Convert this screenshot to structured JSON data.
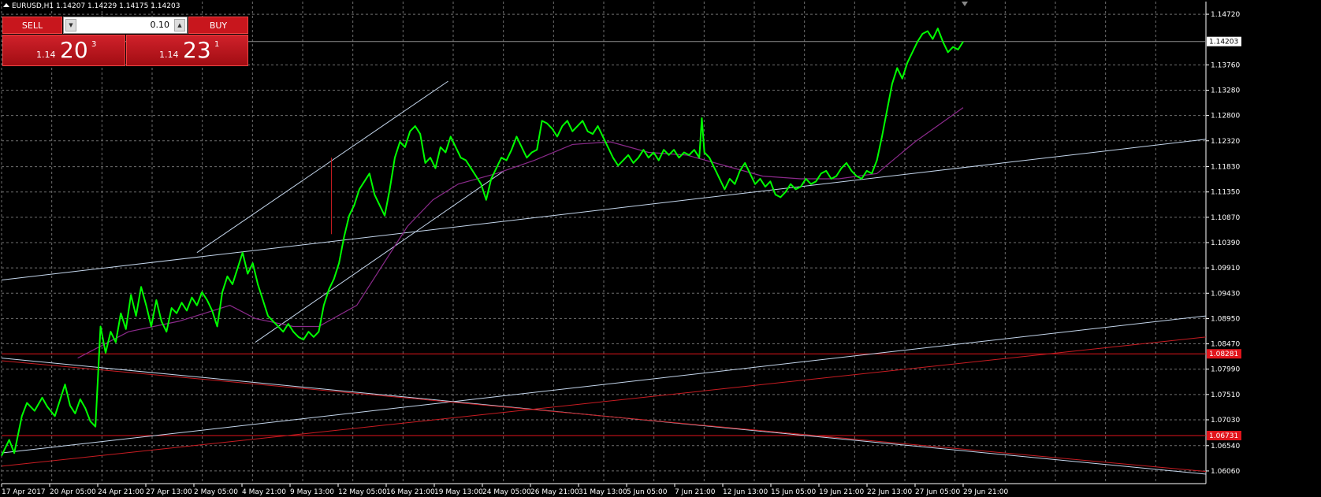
{
  "header": {
    "title": "EURUSD,H1  1.14207 1.14229 1.14175 1.14203"
  },
  "trade_panel": {
    "sell_label": "SELL",
    "buy_label": "BUY",
    "lot": "0.10",
    "sell_prefix": "1.14",
    "sell_big": "20",
    "sell_sup": "3",
    "buy_prefix": "1.14",
    "buy_big": "23",
    "buy_sup": "1"
  },
  "colors": {
    "background": "#000000",
    "grid": "#6f6f6f",
    "candles": "#00ff00",
    "moving_average": "#8b2a8b",
    "trendline": "#c4d6ec",
    "horizontal_level": "#e0141b",
    "red_trendline": "#c81c22"
  },
  "chart_data": {
    "type": "line",
    "symbol": "EURUSD",
    "timeframe": "H1",
    "ohlc_last": {
      "open": 1.14207,
      "high": 1.14229,
      "low": 1.14175,
      "close": 1.14203
    },
    "ylim": [
      1.0582,
      1.1496
    ],
    "y_ticks": [
      "1.14720",
      "1.13760",
      "1.13280",
      "1.12800",
      "1.12320",
      "1.11830",
      "1.11350",
      "1.10870",
      "1.10390",
      "1.09910",
      "1.09430",
      "1.08950",
      "1.08470",
      "1.07990",
      "1.07510",
      "1.07030",
      "1.06540",
      "1.06060"
    ],
    "x_ticks": [
      "17 Apr 2017",
      "20 Apr 05:00",
      "24 Apr 21:00",
      "27 Apr 13:00",
      "2 May 05:00",
      "4 May 21:00",
      "9 May 13:00",
      "12 May 05:00",
      "16 May 21:00",
      "19 May 13:00",
      "24 May 05:00",
      "26 May 21:00",
      "31 May 13:00",
      "5 Jun 05:00",
      "7 Jun 21:00",
      "12 Jun 13:00",
      "15 Jun 05:00",
      "19 Jun 21:00",
      "22 Jun 13:00",
      "27 Jun 05:00",
      "29 Jun 21:00"
    ],
    "price_labels": [
      {
        "text": "1.14203",
        "value": 1.14203
      },
      {
        "text": "1.08281",
        "value": 1.08281
      },
      {
        "text": "1.06731",
        "value": 1.06731
      }
    ],
    "series": [
      {
        "values": [
          [
            0,
            1.0635
          ],
          [
            3,
            1.0665
          ],
          [
            5,
            1.064
          ],
          [
            8,
            1.071
          ],
          [
            10,
            1.0735
          ],
          [
            13,
            1.072
          ],
          [
            16,
            1.0745
          ],
          [
            18,
            1.0728
          ],
          [
            21,
            1.071
          ],
          [
            23,
            1.074
          ],
          [
            25,
            1.077
          ],
          [
            27,
            1.073
          ],
          [
            29,
            1.0715
          ],
          [
            31,
            1.0742
          ],
          [
            33,
            1.0725
          ],
          [
            35,
            1.07
          ],
          [
            37,
            1.069
          ],
          [
            39,
            1.088
          ],
          [
            41,
            1.083
          ],
          [
            43,
            1.087
          ],
          [
            45,
            1.085
          ],
          [
            47,
            1.0905
          ],
          [
            49,
            1.0875
          ],
          [
            51,
            1.094
          ],
          [
            53,
            1.09
          ],
          [
            55,
            1.0955
          ],
          [
            57,
            1.092
          ],
          [
            59,
            1.088
          ],
          [
            61,
            1.093
          ],
          [
            63,
            1.089
          ],
          [
            65,
            1.087
          ],
          [
            67,
            1.0915
          ],
          [
            69,
            1.0905
          ],
          [
            71,
            1.0925
          ],
          [
            73,
            1.091
          ],
          [
            75,
            1.0935
          ],
          [
            77,
            1.092
          ],
          [
            79,
            1.0945
          ],
          [
            81,
            1.093
          ],
          [
            83,
            1.091
          ],
          [
            85,
            1.088
          ],
          [
            87,
            1.0945
          ],
          [
            89,
            1.0975
          ],
          [
            91,
            1.096
          ],
          [
            93,
            1.099
          ],
          [
            95,
            1.102
          ],
          [
            97,
            1.098
          ],
          [
            99,
            1.1
          ],
          [
            101,
            1.096
          ],
          [
            103,
            1.093
          ],
          [
            105,
            1.09
          ],
          [
            107,
            1.089
          ],
          [
            109,
            1.088
          ],
          [
            111,
            1.087
          ],
          [
            113,
            1.0885
          ],
          [
            115,
            1.087
          ],
          [
            117,
            1.086
          ],
          [
            119,
            1.0855
          ],
          [
            121,
            1.087
          ],
          [
            123,
            1.086
          ],
          [
            125,
            1.087
          ],
          [
            127,
            1.092
          ],
          [
            129,
            1.095
          ],
          [
            131,
            1.097
          ],
          [
            133,
            1.1
          ],
          [
            135,
            1.105
          ],
          [
            137,
            1.109
          ],
          [
            139,
            1.111
          ],
          [
            141,
            1.114
          ],
          [
            143,
            1.1155
          ],
          [
            145,
            1.117
          ],
          [
            147,
            1.113
          ],
          [
            149,
            1.111
          ],
          [
            151,
            1.109
          ],
          [
            153,
            1.114
          ],
          [
            155,
            1.12
          ],
          [
            157,
            1.123
          ],
          [
            159,
            1.122
          ],
          [
            161,
            1.125
          ],
          [
            163,
            1.126
          ],
          [
            165,
            1.1245
          ],
          [
            167,
            1.119
          ],
          [
            169,
            1.12
          ],
          [
            171,
            1.118
          ],
          [
            173,
            1.122
          ],
          [
            175,
            1.121
          ],
          [
            177,
            1.124
          ],
          [
            179,
            1.122
          ],
          [
            181,
            1.12
          ],
          [
            183,
            1.1195
          ],
          [
            185,
            1.118
          ],
          [
            187,
            1.1165
          ],
          [
            189,
            1.115
          ],
          [
            191,
            1.112
          ],
          [
            193,
            1.116
          ],
          [
            195,
            1.118
          ],
          [
            197,
            1.12
          ],
          [
            199,
            1.1195
          ],
          [
            201,
            1.1215
          ],
          [
            203,
            1.124
          ],
          [
            205,
            1.122
          ],
          [
            207,
            1.12
          ],
          [
            209,
            1.121
          ],
          [
            211,
            1.1215
          ],
          [
            213,
            1.127
          ],
          [
            215,
            1.1265
          ],
          [
            217,
            1.1255
          ],
          [
            219,
            1.124
          ],
          [
            221,
            1.126
          ],
          [
            223,
            1.127
          ],
          [
            225,
            1.125
          ],
          [
            227,
            1.126
          ],
          [
            229,
            1.127
          ],
          [
            231,
            1.125
          ],
          [
            233,
            1.1245
          ],
          [
            235,
            1.126
          ],
          [
            237,
            1.124
          ],
          [
            239,
            1.122
          ],
          [
            241,
            1.12
          ],
          [
            243,
            1.1185
          ],
          [
            245,
            1.1195
          ],
          [
            247,
            1.1205
          ],
          [
            249,
            1.119
          ],
          [
            251,
            1.12
          ],
          [
            253,
            1.1215
          ],
          [
            255,
            1.12
          ],
          [
            257,
            1.121
          ],
          [
            259,
            1.1195
          ],
          [
            261,
            1.1215
          ],
          [
            263,
            1.1205
          ],
          [
            265,
            1.1215
          ],
          [
            267,
            1.12
          ],
          [
            269,
            1.121
          ],
          [
            271,
            1.1205
          ],
          [
            273,
            1.1215
          ],
          [
            275,
            1.12
          ],
          [
            276,
            1.1275
          ],
          [
            277,
            1.121
          ],
          [
            279,
            1.12
          ],
          [
            281,
            1.118
          ],
          [
            283,
            1.116
          ],
          [
            285,
            1.114
          ],
          [
            287,
            1.116
          ],
          [
            289,
            1.115
          ],
          [
            291,
            1.1175
          ],
          [
            293,
            1.119
          ],
          [
            295,
            1.117
          ],
          [
            297,
            1.115
          ],
          [
            299,
            1.116
          ],
          [
            301,
            1.1145
          ],
          [
            303,
            1.1155
          ],
          [
            305,
            1.113
          ],
          [
            307,
            1.1125
          ],
          [
            309,
            1.1135
          ],
          [
            311,
            1.115
          ],
          [
            313,
            1.114
          ],
          [
            315,
            1.1145
          ],
          [
            317,
            1.116
          ],
          [
            319,
            1.115
          ],
          [
            321,
            1.1155
          ],
          [
            323,
            1.117
          ],
          [
            325,
            1.1175
          ],
          [
            327,
            1.116
          ],
          [
            329,
            1.1165
          ],
          [
            331,
            1.118
          ],
          [
            333,
            1.119
          ],
          [
            335,
            1.1175
          ],
          [
            337,
            1.1165
          ],
          [
            339,
            1.116
          ],
          [
            341,
            1.1175
          ],
          [
            343,
            1.117
          ],
          [
            345,
            1.1195
          ],
          [
            347,
            1.124
          ],
          [
            349,
            1.129
          ],
          [
            351,
            1.134
          ],
          [
            353,
            1.137
          ],
          [
            355,
            1.135
          ],
          [
            357,
            1.138
          ],
          [
            359,
            1.14
          ],
          [
            361,
            1.142
          ],
          [
            363,
            1.1435
          ],
          [
            365,
            1.144
          ],
          [
            367,
            1.1425
          ],
          [
            369,
            1.1445
          ],
          [
            371,
            1.142
          ],
          [
            373,
            1.14
          ],
          [
            375,
            1.141
          ],
          [
            377,
            1.1405
          ],
          [
            379,
            1.142
          ]
        ]
      },
      {
        "values": [
          [
            30,
            1.082
          ],
          [
            50,
            1.087
          ],
          [
            70,
            1.089
          ],
          [
            90,
            1.092
          ],
          [
            100,
            1.0895
          ],
          [
            115,
            1.088
          ],
          [
            125,
            1.088
          ],
          [
            140,
            1.092
          ],
          [
            150,
            1.0995
          ],
          [
            160,
            1.107
          ],
          [
            170,
            1.112
          ],
          [
            180,
            1.115
          ],
          [
            195,
            1.117
          ],
          [
            210,
            1.1195
          ],
          [
            225,
            1.1225
          ],
          [
            240,
            1.123
          ],
          [
            255,
            1.121
          ],
          [
            270,
            1.1205
          ],
          [
            285,
            1.1185
          ],
          [
            300,
            1.1165
          ],
          [
            315,
            1.116
          ],
          [
            330,
            1.116
          ],
          [
            345,
            1.117
          ],
          [
            360,
            1.123
          ],
          [
            379,
            1.1295
          ]
        ]
      }
    ],
    "trendlines": [
      {
        "color": "white",
        "from": [
          0,
          1.0968
        ],
        "to": [
          379,
          1.1235
        ]
      },
      {
        "color": "white",
        "from": [
          77,
          1.102
        ],
        "to": [
          176,
          1.1345
        ]
      },
      {
        "color": "white",
        "from": [
          100,
          1.085
        ],
        "to": [
          198,
          1.1175
        ]
      },
      {
        "color": "white",
        "from": [
          0,
          1.082
        ],
        "to": [
          379,
          1.06
        ]
      },
      {
        "color": "white",
        "from": [
          0,
          1.064
        ],
        "to": [
          379,
          1.09
        ]
      },
      {
        "color": "red",
        "from": [
          0,
          1.0615
        ],
        "to": [
          379,
          1.086
        ]
      },
      {
        "color": "red",
        "from": [
          0,
          1.0815
        ],
        "to": [
          379,
          1.0605
        ]
      },
      {
        "color": "red",
        "from": [
          130,
          1.12
        ],
        "to": [
          130,
          1.1055
        ]
      }
    ],
    "levels": [
      {
        "value": 1.08281,
        "color": "red"
      },
      {
        "value": 1.06731,
        "color": "red"
      },
      {
        "value": 1.14203,
        "color": "gray"
      }
    ],
    "grid": true
  }
}
